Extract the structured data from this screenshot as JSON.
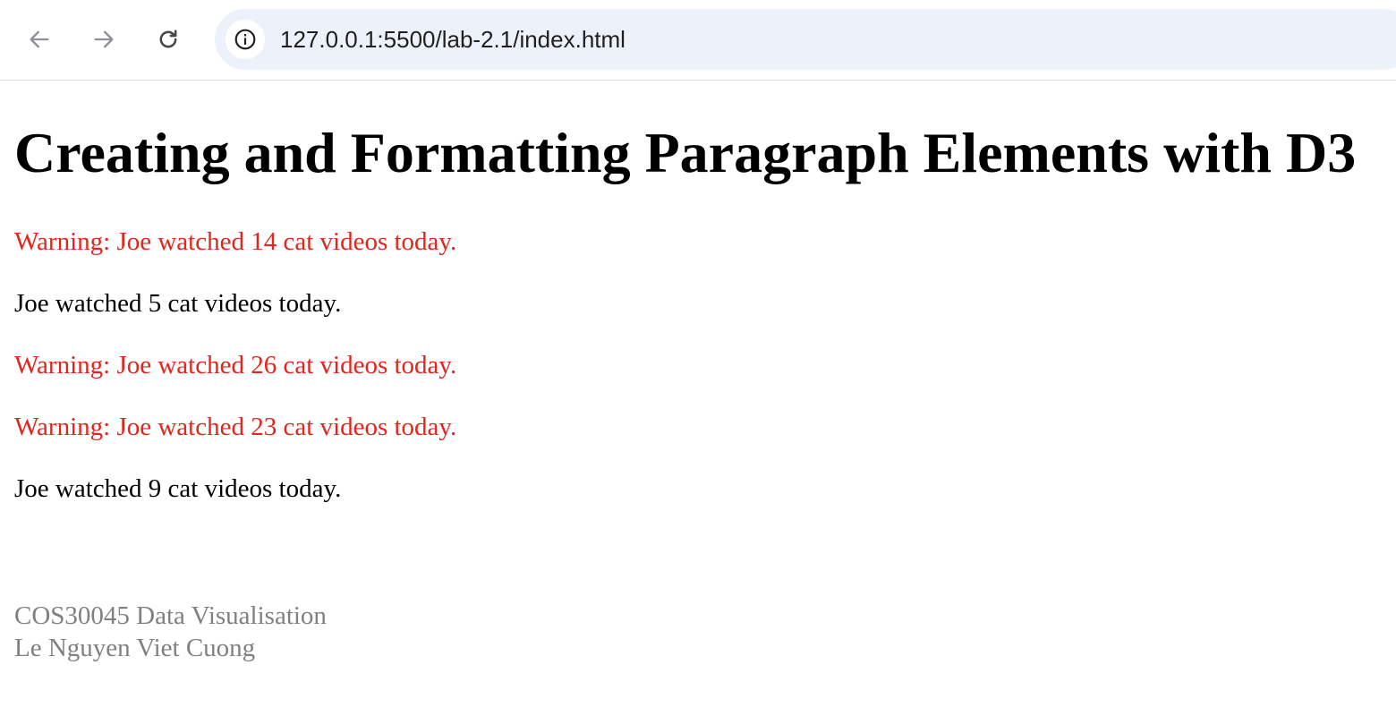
{
  "browser": {
    "url": "127.0.0.1:5500/lab-2.1/index.html",
    "icons": {
      "back": "arrow-left-icon",
      "forward": "arrow-right-icon",
      "reload": "reload-icon",
      "site_info": "info-icon"
    }
  },
  "page": {
    "title": "Creating and Formatting Paragraph Elements with D3",
    "paragraphs": [
      {
        "text": "Warning: Joe watched 14 cat videos today.",
        "color": "#e0261d"
      },
      {
        "text": "Joe watched 5 cat videos today.",
        "color": "#000000"
      },
      {
        "text": "Warning: Joe watched 26 cat videos today.",
        "color": "#e0261d"
      },
      {
        "text": "Warning: Joe watched 23 cat videos today.",
        "color": "#e0261d"
      },
      {
        "text": "Joe watched 9 cat videos today.",
        "color": "#000000"
      }
    ],
    "footer": {
      "course": "COS30045 Data Visualisation",
      "author": "Le Nguyen Viet Cuong",
      "color": "#808080"
    }
  }
}
